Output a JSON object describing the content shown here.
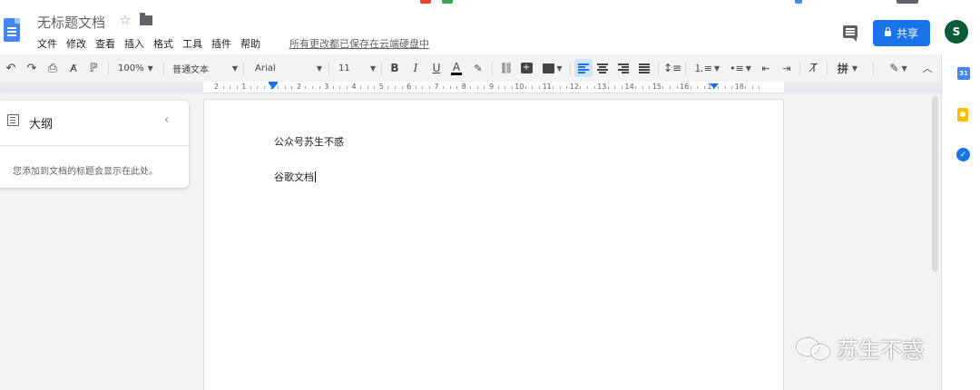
{
  "header": {
    "doc_title": "无标题文档",
    "menu": [
      "文件",
      "修改",
      "查看",
      "插入",
      "格式",
      "工具",
      "插件",
      "帮助"
    ],
    "save_status": "所有更改都已保存在云端硬盘中",
    "share_label": "共享",
    "avatar_letter": "S"
  },
  "toolbar": {
    "zoom": "100%",
    "style": "普通文本",
    "font": "Arial",
    "font_size": "11",
    "input_tool": "拼"
  },
  "ruler": {
    "numbers": [
      "2",
      "1",
      "1",
      "2",
      "3",
      "4",
      "5",
      "6",
      "7",
      "8",
      "9",
      "10",
      "11",
      "12",
      "13",
      "14",
      "15",
      "16",
      "17",
      "18"
    ]
  },
  "outline": {
    "title": "大纲",
    "hint": "您添加到文档的标题会显示在此处。"
  },
  "document": {
    "paragraphs": [
      "公众号苏生不惑",
      "谷歌文档"
    ]
  },
  "sidepanel": {
    "calendar_label": "31"
  },
  "watermark": {
    "text": "苏生不惑"
  },
  "colors": {
    "accent": "#1a73e8",
    "avatar_bg": "#0a5c36",
    "toolbar_bg": "#f1f3f4"
  }
}
